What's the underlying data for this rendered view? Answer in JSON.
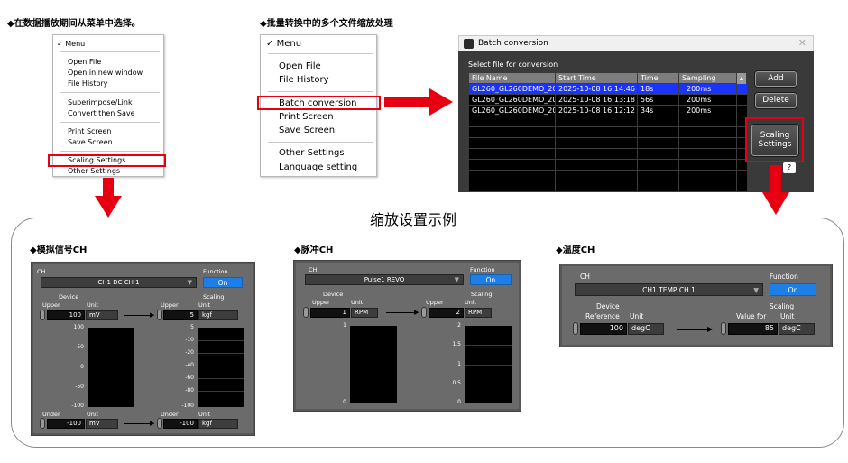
{
  "notes": {
    "left": "◆在数据播放期间从菜单中选择。",
    "middle": "◆批量转换中的多个文件缩放处理"
  },
  "menu1": {
    "header": "Menu",
    "items": [
      "Open File",
      "Open in new window",
      "File History",
      "Superimpose/Link",
      "Convert then Save",
      "Print Screen",
      "Save Screen",
      "Scaling Settings",
      "Other Settings"
    ]
  },
  "menu2": {
    "header": "Menu",
    "items": [
      "Open File",
      "File History",
      "Batch conversion",
      "Print Screen",
      "Save Screen",
      "Other Settings",
      "Language setting"
    ]
  },
  "batch": {
    "title": "Batch conversion",
    "select_label": "Select file for conversion",
    "columns": [
      "File Name",
      "Start Time",
      "Time",
      "Sampling"
    ],
    "rows": [
      [
        "GL260_GL260DEMO_20...",
        "2025-10-08 16:14:46",
        "18s",
        "200ms"
      ],
      [
        "GL260_GL260DEMO_20...",
        "2025-10-08 16:13:18",
        "56s",
        "200ms"
      ],
      [
        "GL260_GL260DEMO_20...",
        "2025-10-08 16:12:12",
        "34s",
        "200ms"
      ]
    ],
    "add": "Add",
    "delete": "Delete",
    "scaling_line1": "Scaling",
    "scaling_line2": "Settings",
    "help": "?"
  },
  "section_title": "缩放设置示例",
  "panels": [
    {
      "note": "◆模拟信号CH",
      "ch_label": "CH",
      "ch_value": "CH1 DC  CH 1",
      "function_label": "Function",
      "on": "On",
      "device": "Device",
      "upper": "Upper",
      "unit": "Unit",
      "scaling": "Scaling",
      "dev_upper": "100",
      "dev_upper_unit": "mV",
      "scl_upper": "5",
      "scl_upper_unit": "kgf",
      "left_ticks": [
        "100",
        "50",
        "0",
        "-50",
        "-100"
      ],
      "right_ticks": [
        "5",
        "-10",
        "-20",
        "-40",
        "-60",
        "-80",
        "-100"
      ],
      "under": "Under",
      "dev_under": "-100",
      "dev_under_unit": "mV",
      "scl_under": "-100",
      "scl_under_unit": "kgf"
    },
    {
      "note": "◆脉冲CH",
      "ch_label": "CH",
      "ch_value": "Pulse1 REVO",
      "function_label": "Function",
      "on": "On",
      "device": "Device",
      "upper": "Upper",
      "unit": "Unit",
      "scaling": "Scaling",
      "dev_upper": "1",
      "dev_upper_unit": "RPM",
      "scl_upper": "2",
      "scl_upper_unit": "RPM",
      "left_ticks": [
        "1",
        "0"
      ],
      "right_ticks": [
        "2",
        "1.5",
        "1",
        "0.5",
        "0"
      ]
    },
    {
      "note": "◆温度CH",
      "ch_label": "CH",
      "ch_value": "CH1 TEMP  CH 1",
      "function_label": "Function",
      "on": "On",
      "device": "Device",
      "reference": "Reference",
      "unit": "Unit",
      "scaling": "Scaling",
      "value_for": "Value for",
      "dev_ref": "100",
      "dev_ref_unit": "degC",
      "scl_val": "85",
      "scl_val_unit": "degC"
    }
  ],
  "colors": {
    "red": "#e60012",
    "accent_blue": "#1d7fe6",
    "select_blue": "#1a33ff"
  }
}
